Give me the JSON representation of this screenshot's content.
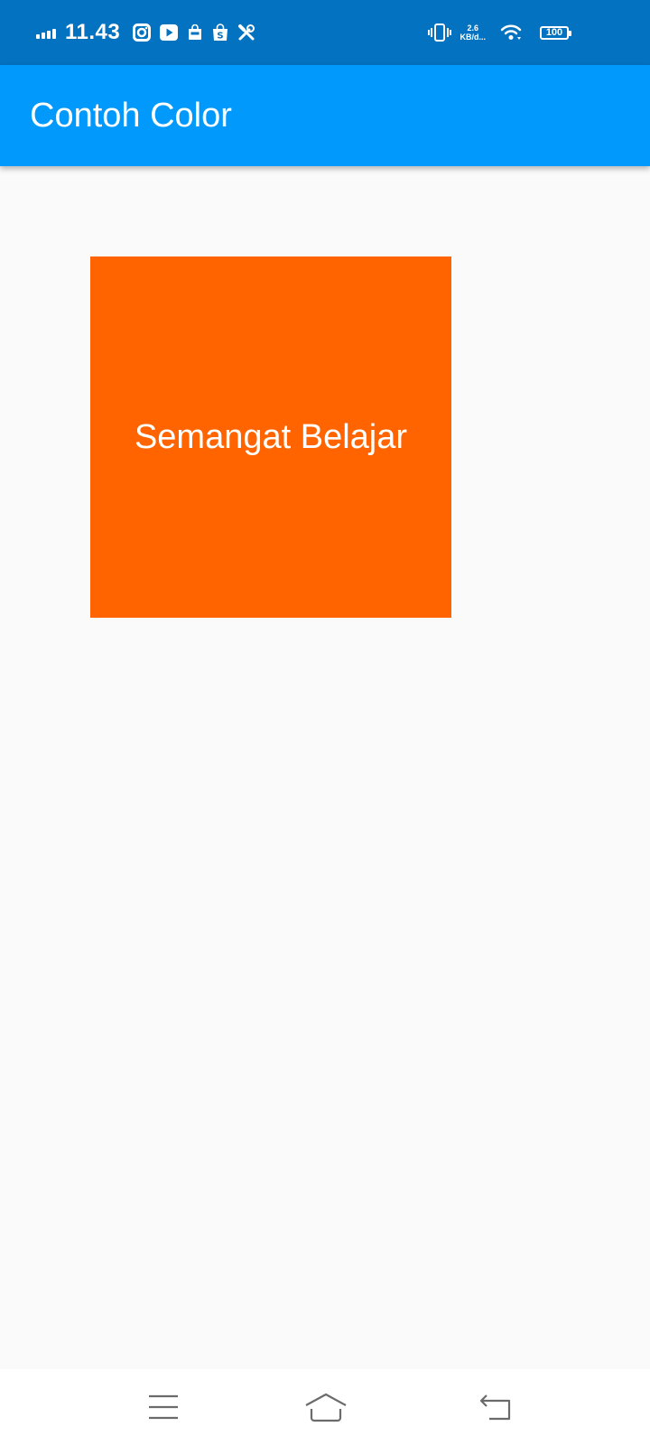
{
  "status_bar": {
    "time": "11.43",
    "network_speed_value": "2.6",
    "network_speed_unit": "KB/d...",
    "battery_level": "100",
    "icons": [
      "signal-icon",
      "instagram-icon",
      "youtube-icon",
      "bag-icon",
      "shopee-icon",
      "tools-icon",
      "vibrate-icon",
      "wifi-icon",
      "battery-icon"
    ],
    "background_color": "#0372c0"
  },
  "app_bar": {
    "title": "Contoh Color",
    "background_color": "#0299fc"
  },
  "content": {
    "box_text": "Semangat Belajar",
    "box_color": "#ff6400",
    "page_background": "#fafafa"
  },
  "nav_bar": {
    "buttons": [
      "menu-icon",
      "home-icon",
      "back-icon"
    ]
  }
}
